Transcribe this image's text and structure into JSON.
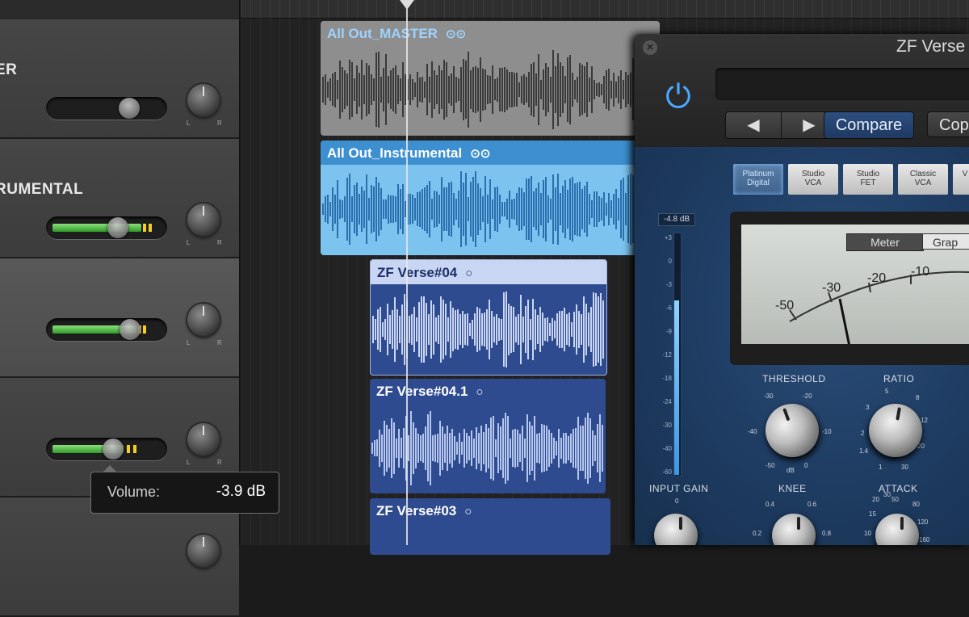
{
  "tracks": [
    {
      "name": "ER"
    },
    {
      "name": "RUMENTAL"
    },
    {
      "name": ""
    },
    {
      "name": ""
    }
  ],
  "pan_labels": {
    "left": "L",
    "right": "R"
  },
  "tooltip": {
    "label": "Volume:",
    "value": "-3.9 dB"
  },
  "regions": [
    {
      "title": "All Out_MASTER",
      "loop": "⊙⊙"
    },
    {
      "title": "All Out_Instrumental",
      "loop": "⊙⊙"
    },
    {
      "title": "ZF Verse#04",
      "loop": "○"
    },
    {
      "title": "ZF Verse#04.1",
      "loop": "○"
    },
    {
      "title": "ZF Verse#03",
      "loop": "○"
    }
  ],
  "plugin": {
    "title": "ZF Verse",
    "close": "×",
    "power": "⏻",
    "prev": "◀",
    "next": "▶",
    "compare": "Compare",
    "copy": "Cop",
    "models": [
      {
        "line1": "Platinum",
        "line2": "Digital"
      },
      {
        "line1": "Studio",
        "line2": "VCA"
      },
      {
        "line1": "Studio",
        "line2": "FET"
      },
      {
        "line1": "Classic",
        "line2": "VCA"
      },
      {
        "line1": "V",
        "line2": ""
      }
    ],
    "input_meter_value": "-4.8 dB",
    "input_meter_fill": 0.72,
    "input_scale": [
      "+3",
      "0",
      "-3",
      "-6",
      "-9",
      "-12",
      "-18",
      "-24",
      "-30",
      "-40",
      "-60"
    ],
    "meter_tab": "Meter",
    "graph_tab": "Grap",
    "vu_scale": [
      "-50",
      "-30",
      "-20",
      "-10"
    ],
    "threshold_label": "THRESHOLD",
    "threshold_ticks": [
      "-30",
      "-20",
      "-40",
      "-10",
      "-50",
      "0",
      "dB"
    ],
    "ratio_label": "RATIO",
    "ratio_ticks": [
      "5",
      "8",
      "3",
      "12",
      "2",
      "20",
      "1.4",
      "30",
      "1"
    ],
    "input_gain_label": "INPUT GAIN",
    "input_gain_tick": "0",
    "knee_label": "KNEE",
    "knee_ticks": [
      "0.4",
      "0.6",
      "0.2",
      "0.8"
    ],
    "attack_label": "ATTACK",
    "attack_ticks": [
      "50",
      "80",
      "15",
      "120",
      "10",
      "160",
      "20",
      "30"
    ]
  },
  "colors": {
    "accent_blue": "#4aa8ff",
    "meter_green": "#4bc23f",
    "region_grey": "#8e8e8e",
    "region_light_blue": "#7cc3ef",
    "region_dark_blue": "#2f4b8f"
  }
}
